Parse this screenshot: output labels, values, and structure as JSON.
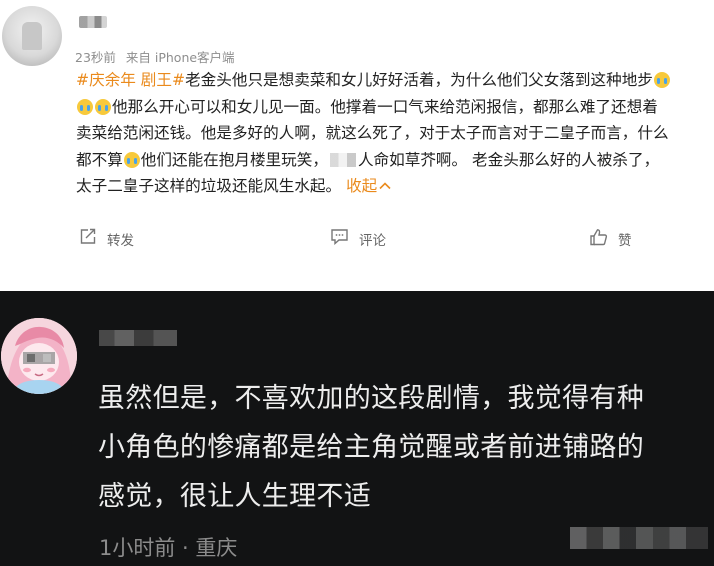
{
  "post": {
    "time": "23秒前",
    "source": "来自 iPhone客户端",
    "hashtag": "#庆余年 剧王#",
    "line1_rest": "老金头他只是想卖菜和女儿好好活着，为什么他们父女落到这种地步",
    "line2_text": "他那么开心可以和女儿见一面。他撑着一口气来给范闲报信，都那么难了还想着",
    "line3": "卖菜给范闲还钱。他是多好的人啊，就这么死了，对于太子而言对于二皇子而言，什么",
    "line4_a": "都不算",
    "line4_b": "他们还能在抱月楼里玩笑，",
    "line4_c": "人命如草芥啊。 老金头那么好的人被杀了，",
    "line5": "太子二皇子这样的垃圾还能风生水起。",
    "collapse_label": "收起",
    "actions": {
      "repost": "转发",
      "comment": "评论",
      "like": "赞"
    },
    "colors": {
      "accent": "#ea8a1c",
      "text": "#222222",
      "meta": "#8e8e8e"
    }
  },
  "comment": {
    "line1": "虽然但是，不喜欢加的这段剧情，我觉得有种",
    "line2": "小角色的惨痛都是给主角觉醒或者前进铺路的",
    "line3": "感觉，很让人生理不适",
    "time": "1小时前 · 重庆",
    "colors": {
      "background": "#121314",
      "text": "#ededed",
      "meta": "#8c8c8c"
    }
  },
  "icons": [
    "repost-icon",
    "comment-icon",
    "like-icon",
    "crying-emoji-icon",
    "chevron-up-icon"
  ]
}
